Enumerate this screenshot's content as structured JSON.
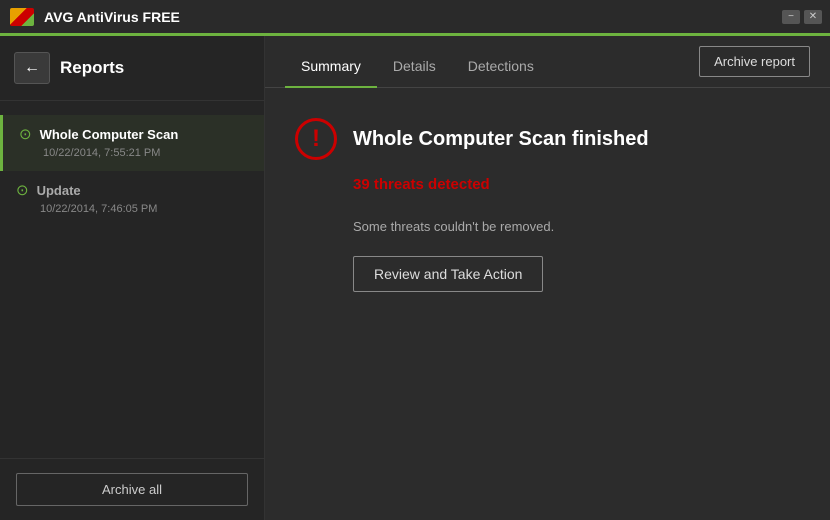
{
  "app": {
    "logo_alt": "AVG logo",
    "title": "AVG  AntiVirus FREE",
    "minimize_label": "−",
    "close_label": "✕"
  },
  "sidebar": {
    "title": "Reports",
    "back_arrow": "←",
    "items": [
      {
        "id": "whole-computer-scan",
        "name": "Whole Computer Scan",
        "date": "10/22/2014, 7:55:21 PM",
        "active": true
      },
      {
        "id": "update",
        "name": "Update",
        "date": "10/22/2014, 7:46:05 PM",
        "active": false
      }
    ],
    "archive_all_label": "Archive all"
  },
  "content": {
    "tabs": [
      {
        "id": "summary",
        "label": "Summary",
        "active": true
      },
      {
        "id": "details",
        "label": "Details",
        "active": false
      },
      {
        "id": "detections",
        "label": "Detections",
        "active": false
      }
    ],
    "archive_report_label": "Archive report",
    "scan_title": "Whole Computer Scan finished",
    "threats_detected": "39 threats detected",
    "threats_message": "Some threats couldn't be removed.",
    "review_action_label": "Review and Take Action"
  },
  "colors": {
    "accent_green": "#6db33f",
    "accent_red": "#cc0000",
    "bg_dark": "#252525",
    "bg_content": "#2c2c2c",
    "text_primary": "#ffffff",
    "text_secondary": "#aaaaaa"
  }
}
